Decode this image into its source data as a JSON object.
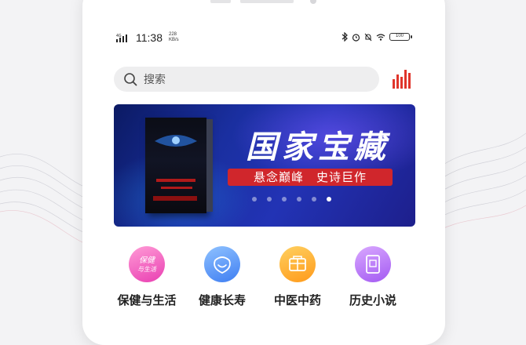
{
  "status_bar": {
    "network": "4G",
    "time": "11:38",
    "speed_value": "228",
    "speed_unit": "KB/s",
    "battery": "100"
  },
  "search": {
    "placeholder": "搜索"
  },
  "banner": {
    "title": "国家宝藏",
    "tagline": "悬念巅峰　史诗巨作",
    "dots_count": 6,
    "active_dot_index": 5
  },
  "categories": [
    {
      "label": "保健与生活",
      "icon": "health-life-icon",
      "icon_text": "保健与生活",
      "color_from": "#ff9bd6",
      "color_to": "#e93fb2"
    },
    {
      "label": "健康长寿",
      "icon": "longevity-icon",
      "color_from": "#8fc2ff",
      "color_to": "#3f7ef2"
    },
    {
      "label": "中医中药",
      "icon": "chinese-medicine-icon",
      "color_from": "#ffd060",
      "color_to": "#ff9a1a"
    },
    {
      "label": "历史小说",
      "icon": "history-novel-icon",
      "color_from": "#d9a8ff",
      "color_to": "#a35af2"
    }
  ],
  "colors": {
    "accent_red": "#e0352b",
    "tag_red": "#d0262c",
    "banner_blue": "#1a2fa0"
  }
}
